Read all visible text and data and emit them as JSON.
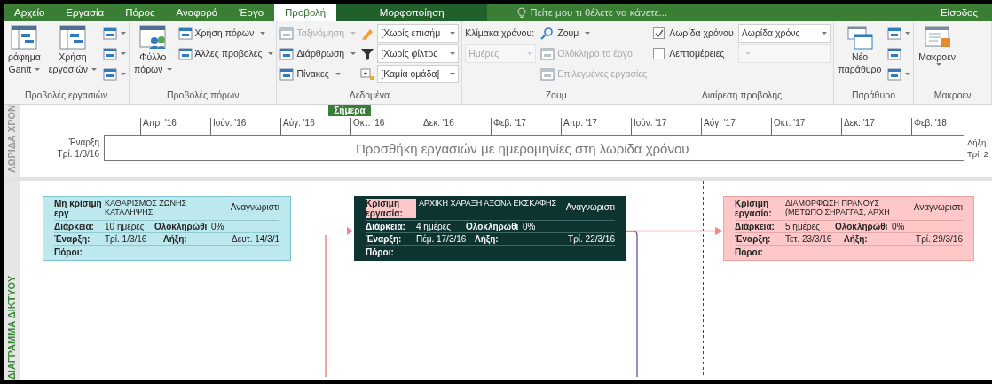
{
  "tabs": [
    {
      "label": "Αρχείο",
      "selected": false,
      "kind": "tab"
    },
    {
      "label": "Εργασία",
      "selected": false,
      "kind": "tab"
    },
    {
      "label": "Πόρος",
      "selected": false,
      "kind": "tab"
    },
    {
      "label": "Αναφορά",
      "selected": false,
      "kind": "tab"
    },
    {
      "label": "Έργο",
      "selected": false,
      "kind": "tab"
    },
    {
      "label": "Προβολή",
      "selected": true,
      "kind": "tab"
    },
    {
      "label": "Μορφοποίηση",
      "selected": false,
      "kind": "contextual"
    }
  ],
  "tell_me": "Πείτε μου τι θέλετε να κάνετε...",
  "sign_in": "Είσοδος",
  "ribbon": {
    "groups": [
      {
        "label": "Προβολές εργασιών",
        "columns": [
          [
            {
              "kind": "large",
              "lines": [
                "ράφημα",
                "Gantt"
              ],
              "menu": true
            }
          ],
          [
            {
              "kind": "large",
              "lines": [
                "Χρήση",
                "εργασιών"
              ],
              "menu": true
            }
          ],
          [
            {
              "kind": "icon",
              "menu": true
            },
            {
              "kind": "icon",
              "menu": true
            },
            {
              "kind": "icon",
              "menu": true
            }
          ]
        ]
      },
      {
        "label": "Προβολές πόρων",
        "columns": [
          [
            {
              "kind": "large",
              "lines": [
                "Φύλλο",
                "πόρων"
              ],
              "menu": true
            }
          ],
          [
            {
              "kind": "small",
              "label": "Χρήση πόρων",
              "menu": true
            },
            {
              "kind": "small",
              "label": "Άλλες προβολές",
              "menu": true
            }
          ]
        ]
      },
      {
        "label": "Δεδομένα",
        "columns": [
          [
            {
              "kind": "small",
              "label": "Ταξινόμηση",
              "menu": true,
              "disabled": true
            },
            {
              "kind": "small",
              "label": "Διάρθρωση",
              "menu": true,
              "disabled": false
            },
            {
              "kind": "small",
              "label": "Πίνακες",
              "menu": true,
              "disabled": false
            }
          ],
          [
            {
              "kind": "combo",
              "value": "[Χωρίς επισήμ",
              "disabled": false
            },
            {
              "kind": "combo",
              "value": "[Χωρίς φίλτρς",
              "disabled": false
            },
            {
              "kind": "combo",
              "value": "[Καμία ομάδα]",
              "disabled": false
            }
          ]
        ]
      },
      {
        "label": "Ζουμ",
        "columns": [
          [
            {
              "kind": "text",
              "label": "Κλίμακα χρόνου:",
              "disabled": false
            },
            {
              "kind": "combo",
              "value": "Ημέρες",
              "disabled": true
            }
          ],
          [
            {
              "kind": "small",
              "label": "Ζουμ",
              "menu": true,
              "disabled": false
            },
            {
              "kind": "small",
              "label": "Ολόκληρο το έργο",
              "menu": false,
              "disabled": true
            },
            {
              "kind": "small",
              "label": "Επιλεγμένες εργασίες",
              "menu": false,
              "disabled": true
            }
          ]
        ]
      },
      {
        "label": "Διαίρεση προβολής",
        "columns": [
          [
            {
              "kind": "checkbox",
              "label": "Λωρίδα χρόνου",
              "checked": true,
              "disabled": false
            },
            {
              "kind": "checkbox",
              "label": "Λεπτομέρειες",
              "checked": false,
              "disabled": false
            }
          ],
          [
            {
              "kind": "combo",
              "value": "Λωρίδα χρόνς",
              "disabled": false
            },
            {
              "kind": "combo",
              "disabled": true
            }
          ]
        ]
      },
      {
        "label": "Παράθυρο",
        "columns": [
          [
            {
              "kind": "large",
              "lines": [
                "Νέο",
                "παράθυρο"
              ],
              "menu": false
            }
          ],
          [
            {
              "kind": "icon",
              "menu": true
            },
            {
              "kind": "icon",
              "menu": false
            },
            {
              "kind": "icon",
              "menu": true
            }
          ]
        ]
      },
      {
        "label": "Μακροεν",
        "columns": [
          [
            {
              "kind": "large",
              "lines": [
                "Μακροεν"
              ],
              "menu": true
            }
          ]
        ]
      }
    ]
  },
  "timeline": {
    "side_label": "ΛΩΡΙΔΑ ΧΡΟΝ",
    "today": "Σήμερα",
    "ticks": [
      "Απρ. '16",
      "Ιούν. '16",
      "Αύγ. '16",
      "Οκτ. '16",
      "Δεκ. '16",
      "Φεβ. '17",
      "Απρ. '17",
      "Ιούν. '17",
      "Αύγ. '17",
      "Οκτ. '17",
      "Δεκ. '17",
      "Φεβ. '18"
    ],
    "start_label": "Έναρξη",
    "start": "Τρί. 1/3/16",
    "finish_label": "Λήξη",
    "finish": "Τρί. 2",
    "hint": "Προσθήκη εργασιών με ημερομηνίες στη λωρίδα χρόνου"
  },
  "network": {
    "side_label": "ΔΙΑΓΡΑΜΜΑ ΔΙΚΤΥΟΥ",
    "nodes": [
      {
        "critical": false,
        "selected": false,
        "type_label": "Μη κρίσιμη εργ",
        "name": "ΚΑΘΑΡΙΣΜΟΣ ΖΩΝΗΣ ΚΑΤΑΛΗΨΗΣ",
        "id_label": "Αναγνωριστι",
        "duration_label": "Διάρκεια:",
        "duration": "10 ημέρες",
        "complete_label": "Ολοκληρώθι",
        "complete": "0%",
        "start_label": "Έναρξη:",
        "start": "Τρί. 1/3/16",
        "finish_label": "Λήξη:",
        "finish": "Δευτ. 14/3/1",
        "resources_label": "Πόροι:"
      },
      {
        "critical": true,
        "selected": true,
        "type_label": "Κρίσιμη εργασία:",
        "name": "ΑΡΧΙΚΗ ΧΑΡΑΞΗ ΑΞΟΝΑ ΕΚΣΚΑΦΗΣ",
        "id_label": "Αναγνωριστι",
        "duration_label": "Διάρκεια:",
        "duration": "4 ημέρες",
        "complete_label": "Ολοκληρώθι",
        "complete": "0%",
        "start_label": "Έναρξη:",
        "start": "Πέμ. 17/3/16",
        "finish_label": "Λήξη:",
        "finish": "Τρί. 22/3/16",
        "resources_label": "Πόροι:"
      },
      {
        "critical": true,
        "selected": false,
        "type_label": "Κρίσιμη εργασία:",
        "name": "ΔΙΑΜΟΡΦΩΣΗ ΠΡΑΝΟΥΣ (ΜΕΤΩΠΟ ΣΗΡΑΓΓΑΣ, ΑΡΧΗ",
        "id_label": "Αναγνωριστι",
        "duration_label": "Διάρκεια:",
        "duration": "5 ημέρες",
        "complete_label": "Ολοκληρώθι",
        "complete": "0%",
        "start_label": "Έναρξη:",
        "start": "Τετ. 23/3/16",
        "finish_label": "Λήξη:",
        "finish": "Τρί. 29/3/16",
        "resources_label": "Πόροι:"
      }
    ]
  }
}
